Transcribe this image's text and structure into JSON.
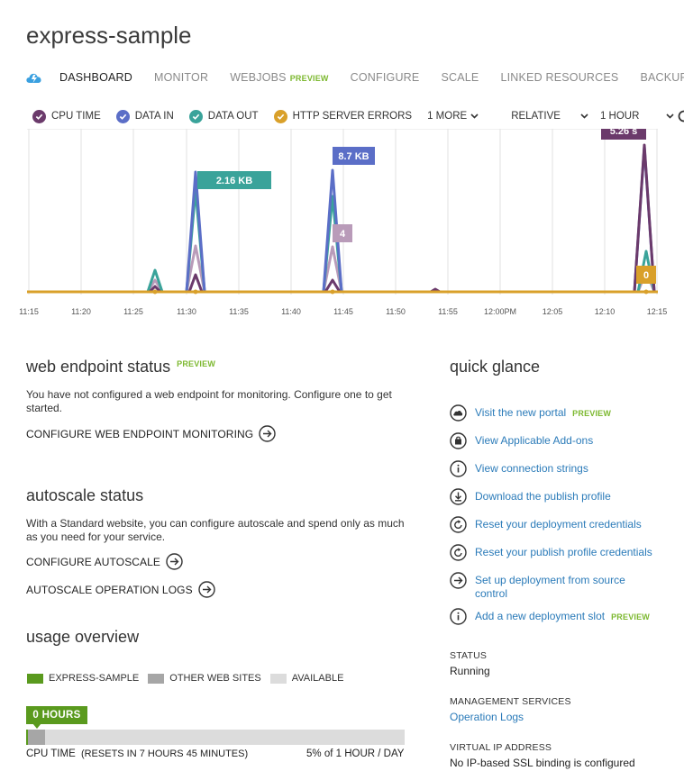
{
  "title": "express-sample",
  "nav": {
    "tabs": [
      {
        "label": "DASHBOARD"
      },
      {
        "label": "MONITOR"
      },
      {
        "label": "WEBJOBS"
      },
      {
        "label": "CONFIGURE"
      },
      {
        "label": "SCALE"
      },
      {
        "label": "LINKED RESOURCES"
      },
      {
        "label": "BACKUPS"
      }
    ],
    "webjobs_badge": "PREVIEW",
    "active_tab": "DASHBOARD"
  },
  "metrics": {
    "items": [
      {
        "label": "CPU TIME",
        "color": "#6b3a6b"
      },
      {
        "label": "DATA IN",
        "color": "#5b6ec7"
      },
      {
        "label": "DATA OUT",
        "color": "#3aa39a"
      },
      {
        "label": "HTTP SERVER ERRORS",
        "color": "#d9a02a"
      }
    ],
    "more_label": "1 MORE",
    "relative_label": "RELATIVE",
    "range_label": "1 HOUR"
  },
  "chart_data": {
    "type": "line",
    "x": [
      "11:15",
      "11:20",
      "11:25",
      "11:30",
      "11:35",
      "11:40",
      "11:45",
      "11:50",
      "11:55",
      "12:00PM",
      "12:05",
      "12:10",
      "12:15"
    ],
    "series": [
      {
        "name": "CPU TIME",
        "color": "#6b3a6b"
      },
      {
        "name": "DATA IN",
        "color": "#5b6ec7"
      },
      {
        "name": "DATA OUT",
        "color": "#3aa39a"
      },
      {
        "name": "HTTP SERVER ERRORS",
        "color": "#d9a02a"
      },
      {
        "color": "#b99bb9"
      }
    ],
    "callouts": [
      {
        "text": "2.16 KB",
        "color": "#3aa39a"
      },
      {
        "text": "8.7 KB",
        "color": "#5b6ec7"
      },
      {
        "text": "4",
        "color": "#b99bb9"
      },
      {
        "text": "5.26 s",
        "color": "#6b3a6b"
      },
      {
        "text": "0",
        "color": "#d9a02a"
      }
    ],
    "grid": true
  },
  "web_endpoint": {
    "heading": "web endpoint status",
    "badge": "PREVIEW",
    "text": "You have not configured a web endpoint for monitoring. Configure one to get started.",
    "action": "CONFIGURE WEB ENDPOINT MONITORING"
  },
  "autoscale": {
    "heading": "autoscale status",
    "text": "With a Standard website, you can configure autoscale and spend only as much as you need for your service.",
    "configure_action": "CONFIGURE AUTOSCALE",
    "logs_action": "AUTOSCALE OPERATION LOGS"
  },
  "usage": {
    "heading": "usage overview",
    "legend": [
      {
        "label": "EXPRESS-SAMPLE",
        "color": "#5a9a1e"
      },
      {
        "label": "OTHER WEB SITES",
        "color": "#a6a6a6"
      },
      {
        "label": "AVAILABLE",
        "color": "#dcdcdc"
      }
    ],
    "badge": "0 HOURS",
    "bar_fraction_used": 0.05,
    "label": "CPU TIME",
    "resets": "(RESETS IN 7 HOURS 45 MINUTES)",
    "quota": "5% of 1 HOUR / DAY"
  },
  "quick_glance": {
    "heading": "quick glance",
    "items": [
      {
        "label": "Visit the new portal",
        "badge": "PREVIEW",
        "icon": "cloud-icon"
      },
      {
        "label": "View Applicable Add-ons",
        "icon": "bag-icon"
      },
      {
        "label": "View connection strings",
        "icon": "info-icon"
      },
      {
        "label": "Download the publish profile",
        "icon": "download-icon"
      },
      {
        "label": "Reset your deployment credentials",
        "icon": "reset-icon"
      },
      {
        "label": "Reset your publish profile credentials",
        "icon": "reset-icon"
      },
      {
        "label": "Set up deployment from source control",
        "icon": "arrow-right-icon"
      },
      {
        "label": "Add a new deployment slot",
        "badge": "PREVIEW",
        "icon": "info-icon"
      }
    ],
    "status_label": "STATUS",
    "status_value": "Running",
    "mgmt_label": "MANAGEMENT SERVICES",
    "mgmt_link": "Operation Logs",
    "vip_label": "VIRTUAL IP ADDRESS",
    "vip_value": "No IP-based SSL binding is configured"
  }
}
